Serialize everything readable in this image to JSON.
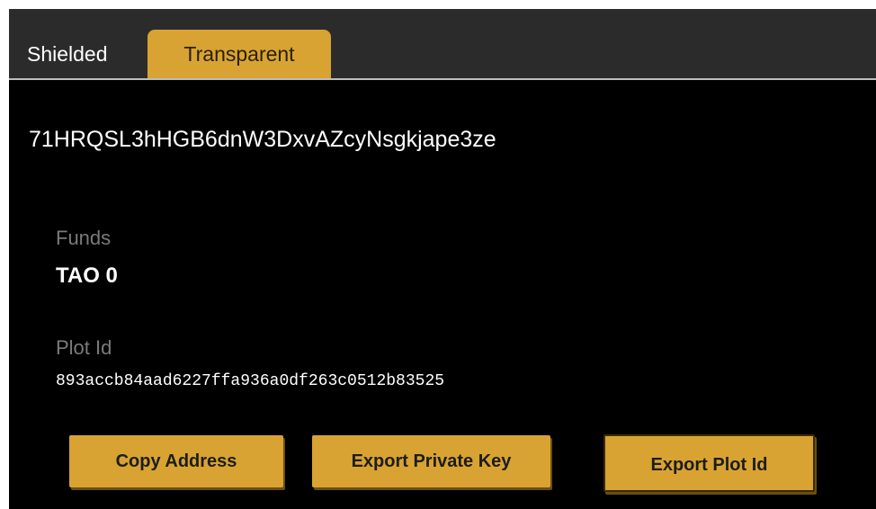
{
  "tabs": {
    "shielded": "Shielded",
    "transparent": "Transparent"
  },
  "address": "71HRQSL3hHGB6dnW3DxvAZcyNsgkjape3ze",
  "funds": {
    "label": "Funds",
    "value": "TAO 0"
  },
  "plot": {
    "label": "Plot Id",
    "value": "893accb84aad6227ffa936a0df263c0512b83525"
  },
  "buttons": {
    "copy_address": "Copy Address",
    "export_private_key": "Export Private Key",
    "export_plot_id": "Export Plot Id"
  },
  "colors": {
    "accent": "#d8a332",
    "background": "#000000",
    "tabbar": "#2b2b2b"
  }
}
